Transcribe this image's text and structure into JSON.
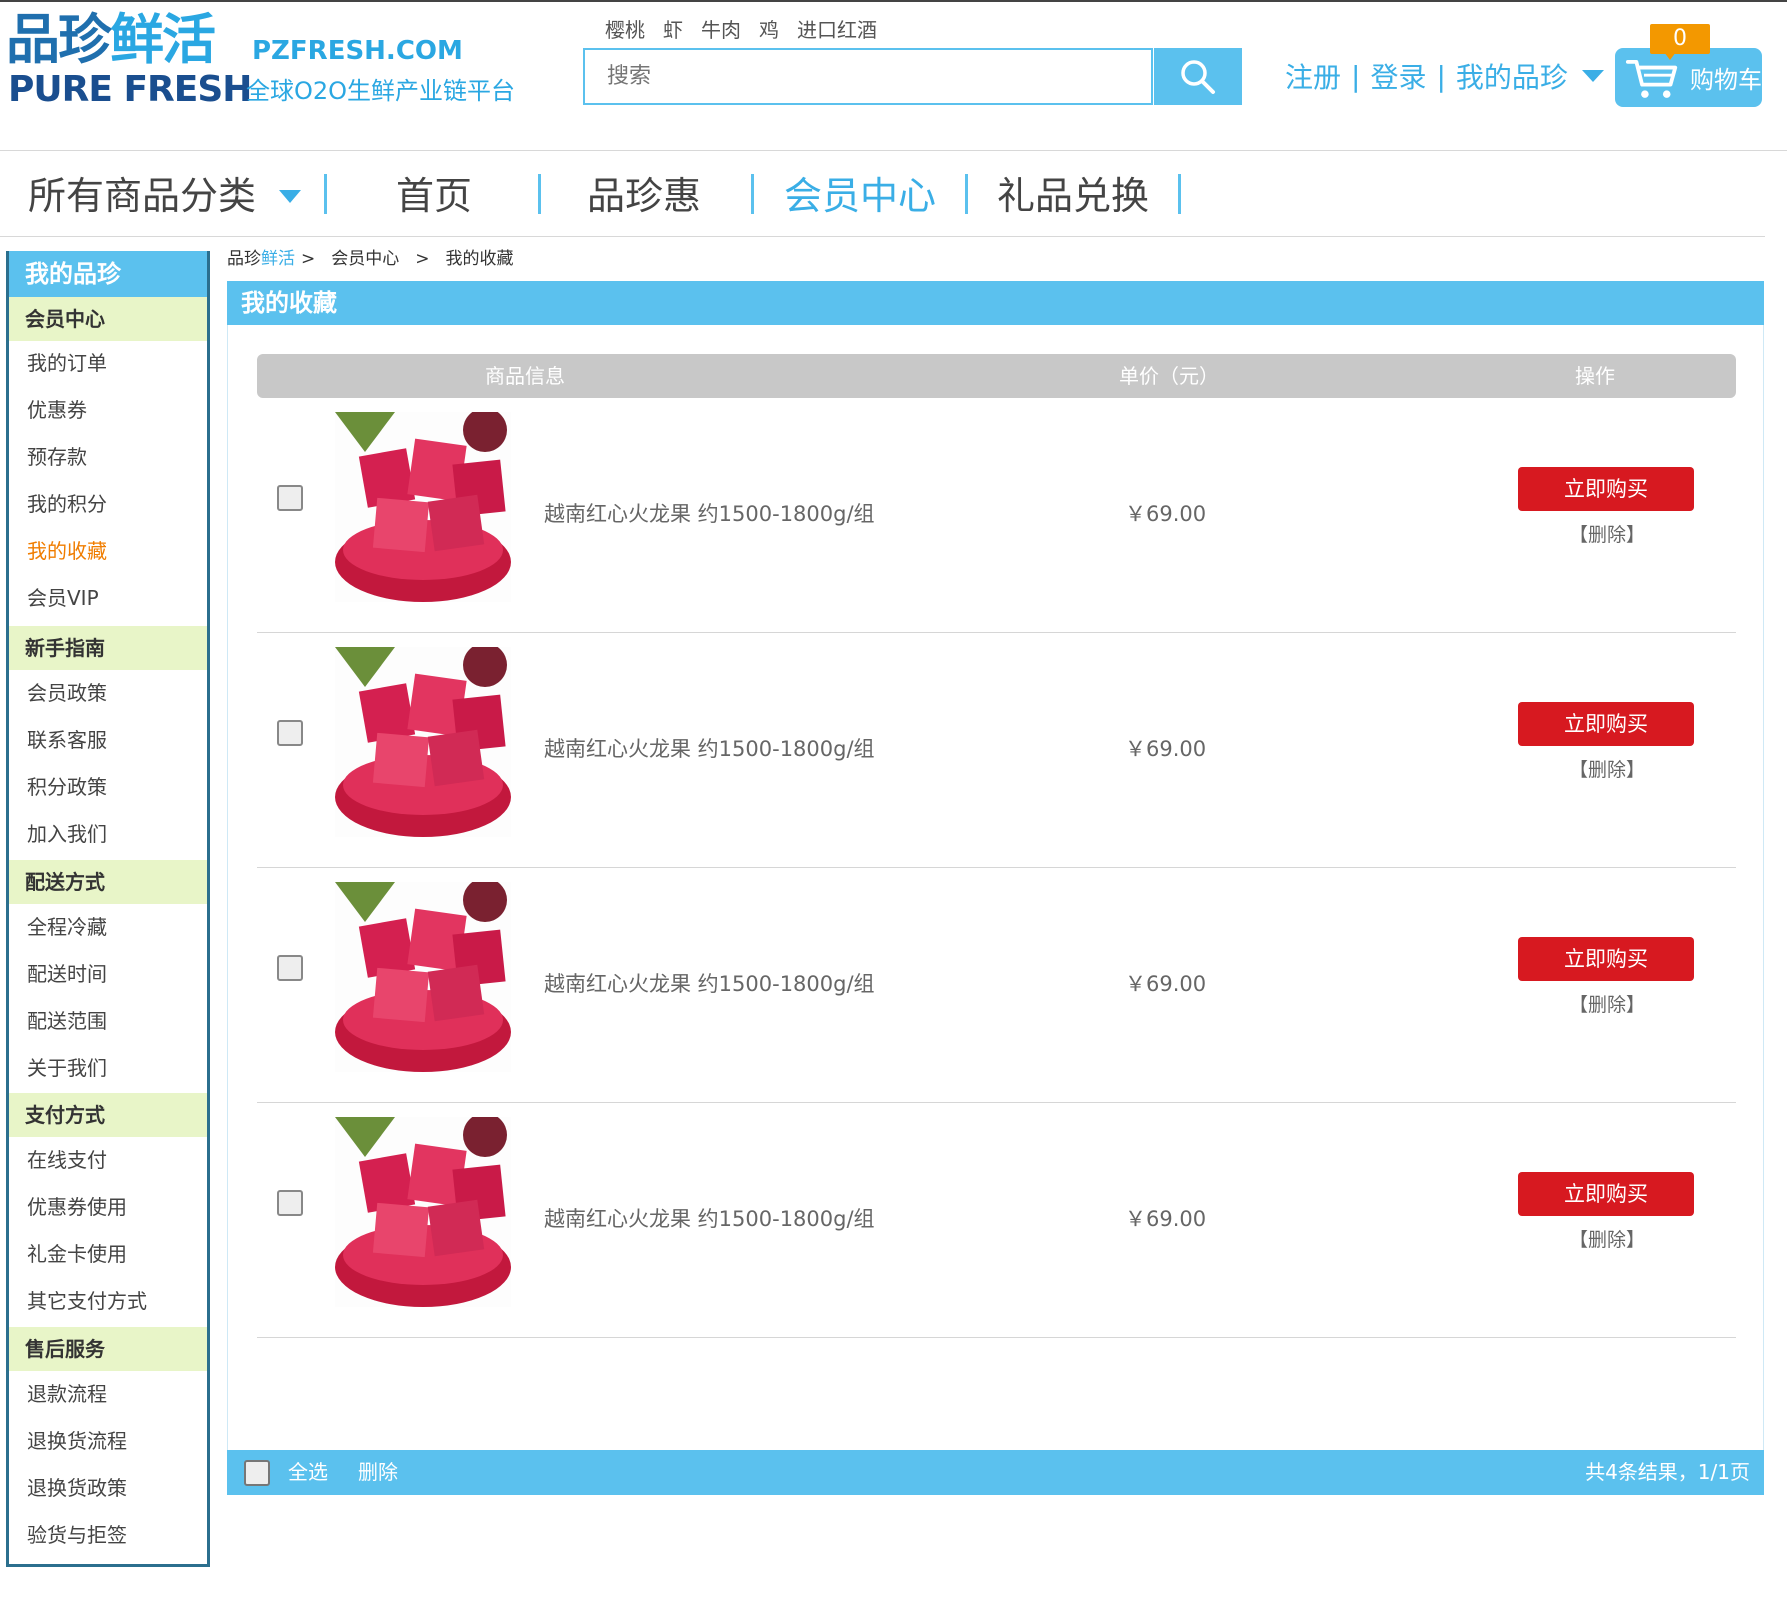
{
  "brand": {
    "logo_cn_a": "品珍",
    "logo_cn_b": "鲜活",
    "logo_en": "PURE FRESH",
    "site_url": "PZFRESH.COM",
    "slogan": "全球O2O生鲜产业链平台"
  },
  "header": {
    "hot_words": [
      "樱桃",
      "虾",
      "牛肉",
      "鸡",
      "进口红酒"
    ],
    "search_placeholder": "搜索",
    "register": "注册",
    "login": "登录",
    "my_pinzhen": "我的品珍",
    "separator": "|",
    "cart_label": "购物车",
    "cart_count": "0"
  },
  "nav": {
    "all_categories": "所有商品分类",
    "home": "首页",
    "pinzhen_hui": "品珍惠",
    "member_center": "会员中心",
    "gift_exchange": "礼品兑换"
  },
  "sidebar": {
    "title": "我的品珍",
    "groups": [
      {
        "label": "会员中心",
        "items": [
          "我的订单",
          "优惠券",
          "预存款",
          "我的积分",
          "我的收藏",
          "会员VIP"
        ]
      },
      {
        "label": "新手指南",
        "items": [
          "会员政策",
          "联系客服",
          "积分政策",
          "加入我们"
        ]
      },
      {
        "label": "配送方式",
        "items": [
          "全程冷藏",
          "配送时间",
          "配送范围",
          "关于我们"
        ]
      },
      {
        "label": "支付方式",
        "items": [
          "在线支付",
          "优惠券使用",
          "礼金卡使用",
          "其它支付方式"
        ]
      },
      {
        "label": "售后服务",
        "items": [
          "退款流程",
          "退换货流程",
          "退换货政策",
          "验货与拒签"
        ]
      }
    ],
    "active_item": "我的收藏"
  },
  "breadcrumb": {
    "root_a": "品珍",
    "root_b": "鲜活",
    "sep": ">",
    "level2": "会员中心",
    "level3": "我的收藏"
  },
  "favorites": {
    "title": "我的收藏",
    "columns": {
      "info": "商品信息",
      "price": "单价（元）",
      "action": "操作"
    },
    "items": [
      {
        "name": "越南红心火龙果 约1500-1800g/组",
        "price": "￥69.00",
        "buy": "立即购买",
        "delete": "【删除】"
      },
      {
        "name": "越南红心火龙果 约1500-1800g/组",
        "price": "￥69.00",
        "buy": "立即购买",
        "delete": "【删除】"
      },
      {
        "name": "越南红心火龙果 约1500-1800g/组",
        "price": "￥69.00",
        "buy": "立即购买",
        "delete": "【删除】"
      },
      {
        "name": "越南红心火龙果 约1500-1800g/组",
        "price": "￥69.00",
        "buy": "立即购买",
        "delete": "【删除】"
      }
    ],
    "select_all": "全选",
    "bulk_delete": "删除",
    "summary": "共4条结果，1/1页"
  },
  "colors": {
    "accent_blue": "#5bc1ee",
    "link_blue": "#3aaee6",
    "buy_red": "#d71920",
    "group_bg": "#e8f5c8",
    "active_orange": "#f07d00",
    "cart_badge": "#f39800"
  },
  "icons": {
    "search": "search-icon",
    "cart": "cart-icon",
    "caret": "caret-down-icon"
  }
}
